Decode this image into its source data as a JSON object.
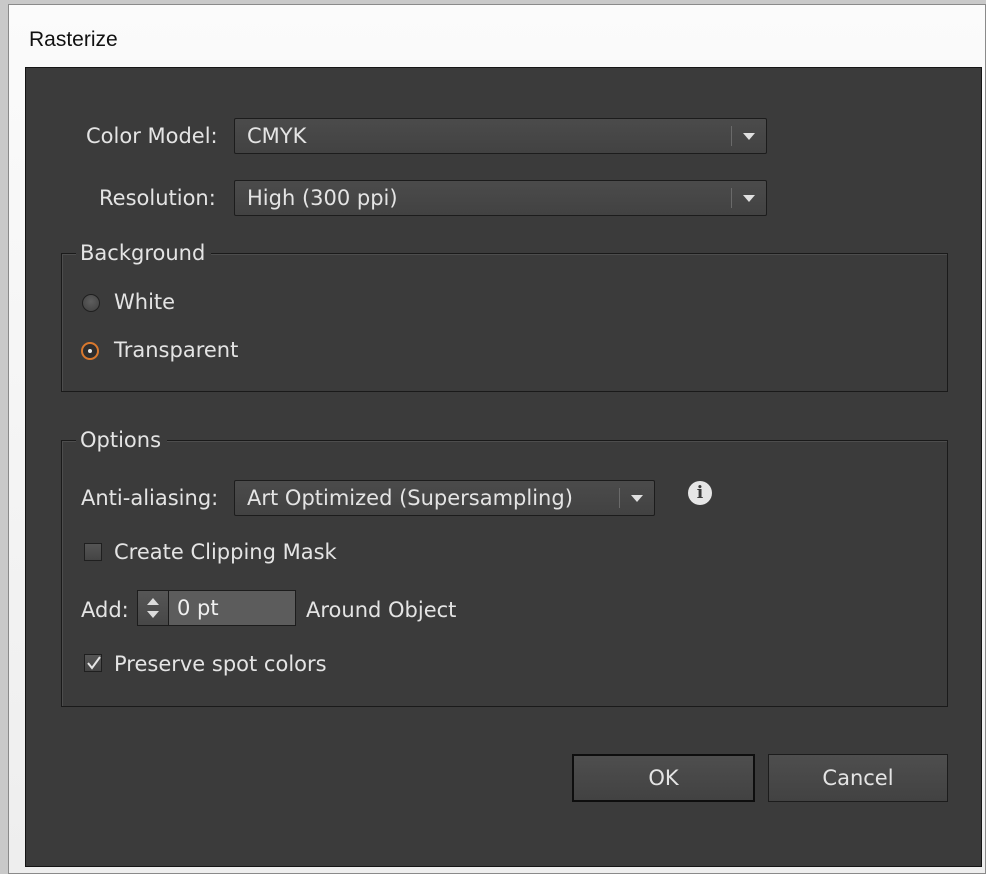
{
  "window": {
    "title": "Rasterize"
  },
  "color_model": {
    "label": "Color Model:",
    "value": "CMYK"
  },
  "resolution": {
    "label": "Resolution:",
    "value": "High (300 ppi)"
  },
  "background": {
    "legend": "Background",
    "options": [
      {
        "label": "White",
        "selected": false
      },
      {
        "label": "Transparent",
        "selected": true
      }
    ]
  },
  "options": {
    "legend": "Options",
    "anti_aliasing": {
      "label": "Anti-aliasing:",
      "value": "Art Optimized (Supersampling)",
      "info_icon": "info-icon"
    },
    "clipping_mask": {
      "label": "Create Clipping Mask",
      "checked": false
    },
    "add": {
      "label": "Add:",
      "value": "0 pt",
      "suffix": "Around Object"
    },
    "spot_colors": {
      "label": "Preserve spot colors",
      "checked": true
    }
  },
  "buttons": {
    "ok": "OK",
    "cancel": "Cancel"
  },
  "colors": {
    "panel": "#3b3b3b",
    "accent_radio": "#d9782d",
    "text": "#e4e4e4"
  }
}
